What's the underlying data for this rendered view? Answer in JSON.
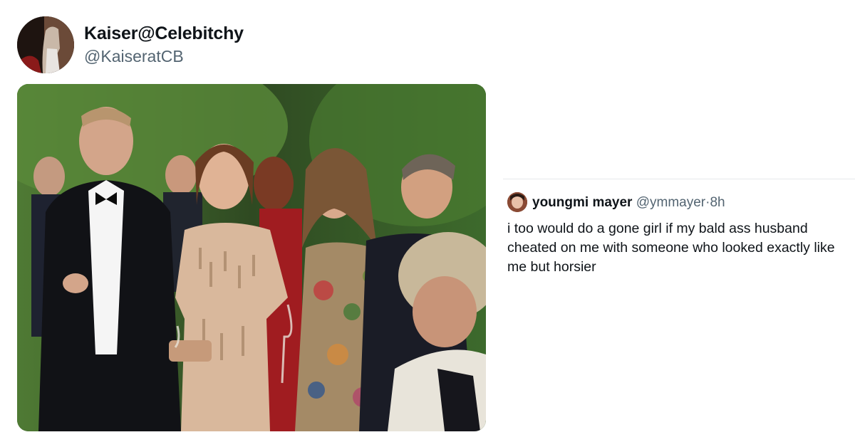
{
  "main_tweet": {
    "author_name": "Kaiser@Celebitchy",
    "author_handle": "@KaiseratCB",
    "media_alt": "Photo of guests in formal attire at an outdoor evening event"
  },
  "reply_tweet": {
    "author_name": "youngmi mayer",
    "author_handle": "@ymmayer",
    "separator": "·",
    "time": "8h",
    "text": "i too would do a gone girl if my bald ass husband cheated on me with someone who looked exactly like me but horsier"
  },
  "colors": {
    "text_primary": "#0f1419",
    "text_secondary": "#536471",
    "divider": "#e6e9eb"
  }
}
